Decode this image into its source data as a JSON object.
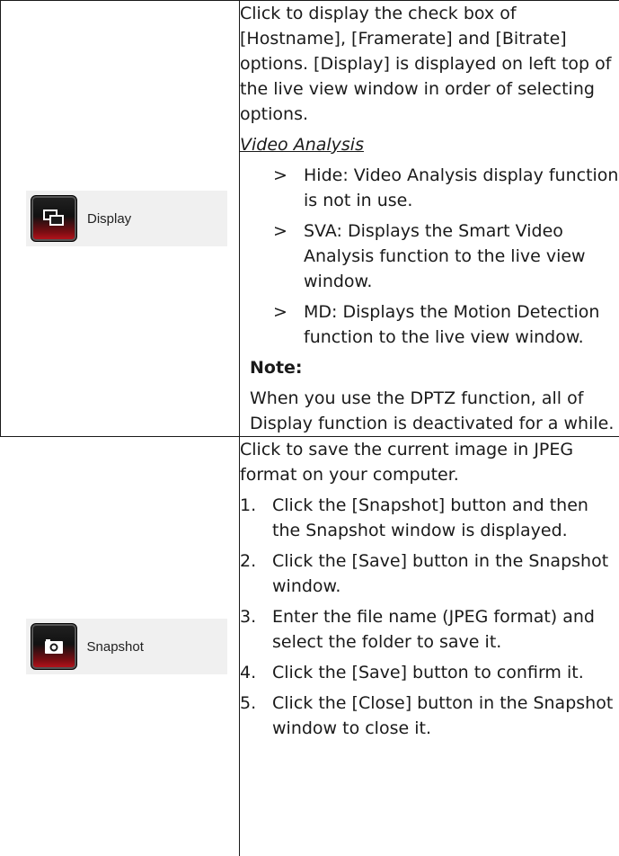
{
  "display": {
    "button": {
      "label": "Display",
      "icon": "display-overlay-icon"
    },
    "intro": "Click to display the check box of [Hostname], [Framerate] and [Bitrate] options. [Display] is displayed on left top of the live view window in order of selecting options.",
    "subheading": "Video Analysis",
    "bullet_marker": ">",
    "bullets": [
      "Hide: Video Analysis display function is not in use.",
      "SVA: Displays the Smart Video Analysis function to the live view window.",
      "MD: Displays the Motion Detection function to the live view window."
    ],
    "note_label": "Note:",
    "note_text": "When you use the DPTZ function, all of Display function is deactivated for a while."
  },
  "snapshot": {
    "button": {
      "label": "Snapshot",
      "icon": "camera-icon"
    },
    "intro": "Click to save the current image in JPEG format on your computer.",
    "steps": [
      {
        "n": "1.",
        "text": "Click the [Snapshot] button and then the Snapshot window is displayed."
      },
      {
        "n": "2.",
        "text": "Click the [Save] button in the Snapshot window."
      },
      {
        "n": "3.",
        "text": "Enter the file name (JPEG format) and select the folder to save it."
      },
      {
        "n": "4.",
        "text": "Click the [Save] button to confirm it."
      },
      {
        "n": "5.",
        "text": "Click the [Close] button in the Snapshot window to close it."
      }
    ]
  },
  "colors": {
    "icon_accent": "#c0141c",
    "border": "#1a1a1a",
    "button_bg": "#f0f0f0"
  }
}
